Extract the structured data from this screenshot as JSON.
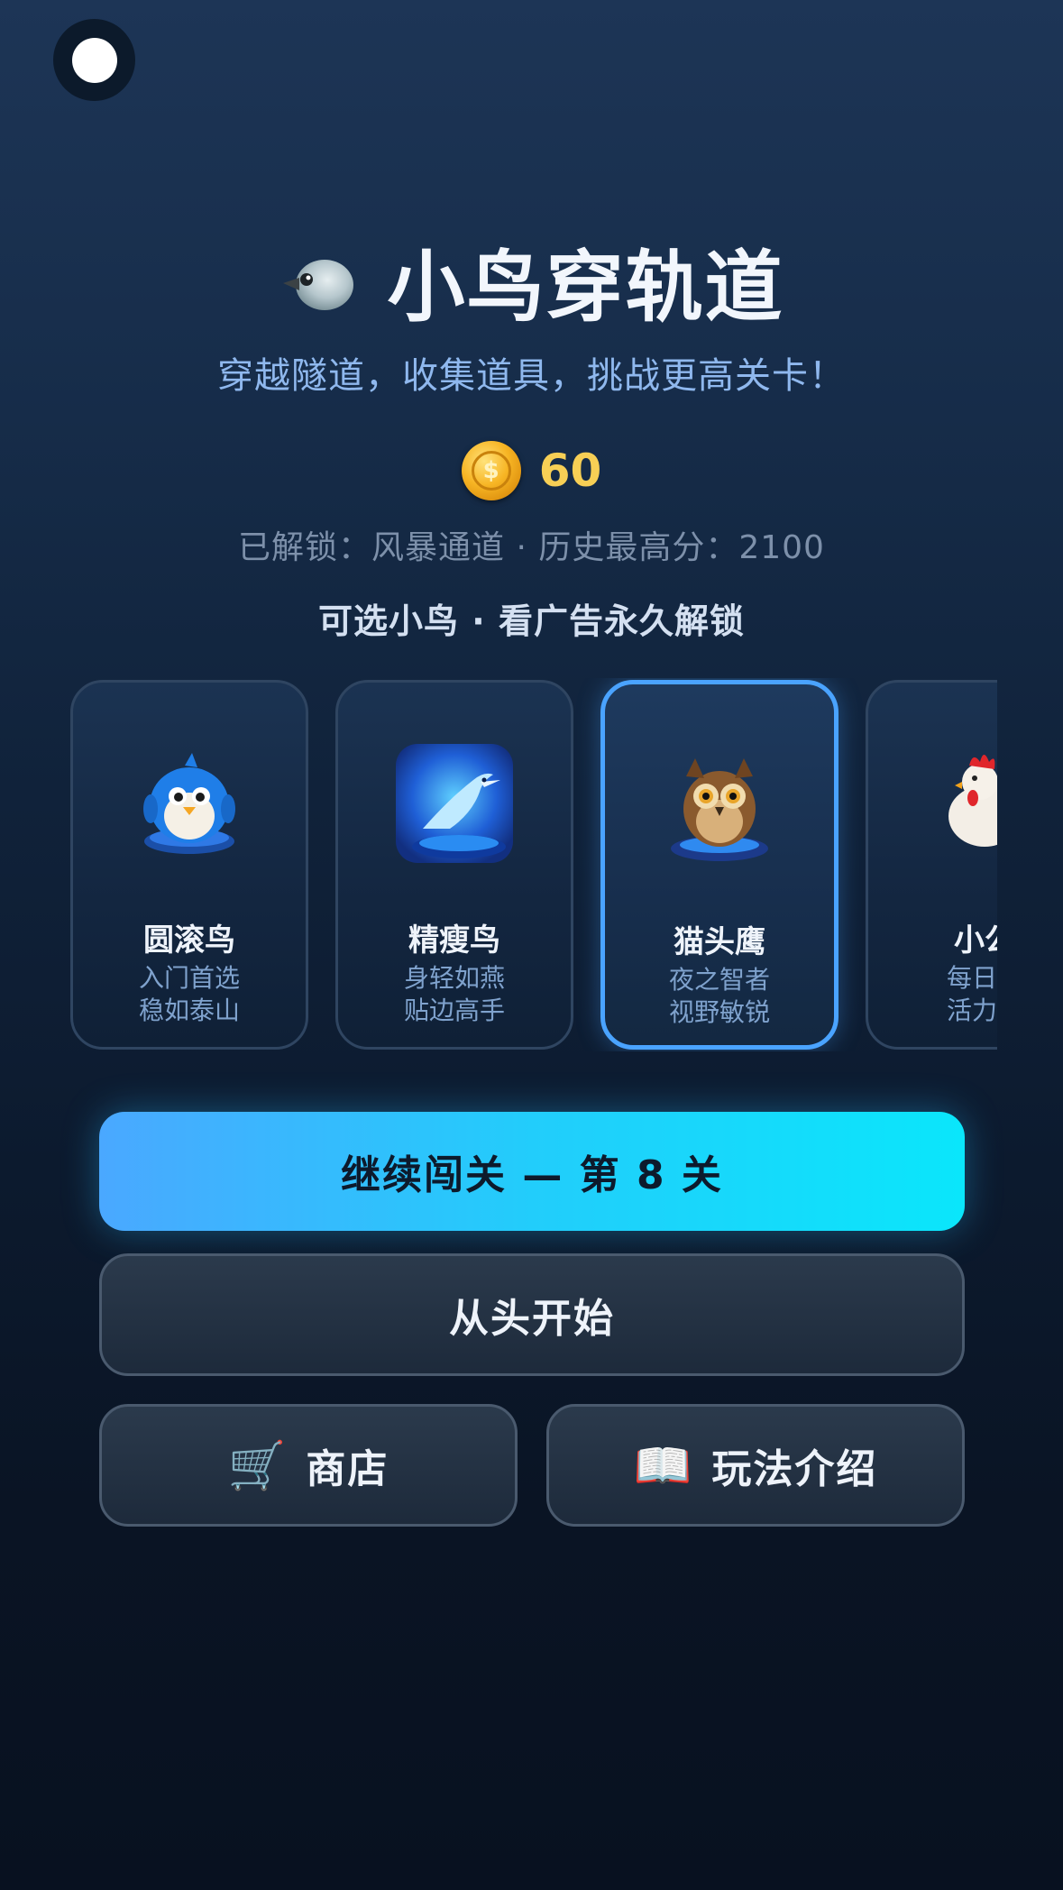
{
  "header": {
    "title": "小鸟穿轨道",
    "title_icon": "pigeon-icon",
    "subtitle": "穿越隧道，收集道具，挑战更高关卡！"
  },
  "wallet": {
    "coin_icon": "coin-icon",
    "coin_symbol": "$",
    "coins": "60"
  },
  "progress": {
    "text": "已解锁：风暴通道 · 历史最高分：2100"
  },
  "bird_select": {
    "title": "可选小鸟 · 看广告永久解锁",
    "selected_index": 2,
    "birds": [
      {
        "name": "圆滚鸟",
        "line1": "入门首选",
        "line2": "稳如泰山",
        "icon": "round-blue-bird-icon"
      },
      {
        "name": "精瘦鸟",
        "line1": "身轻如燕",
        "line2": "贴边高手",
        "icon": "slim-glowing-bird-icon"
      },
      {
        "name": "猫头鹰",
        "line1": "夜之智者",
        "line2": "视野敏锐",
        "icon": "owl-icon"
      },
      {
        "name": "小公",
        "line1": "每日打",
        "line2": "活力四",
        "icon": "rooster-icon"
      }
    ]
  },
  "buttons": {
    "continue": "继续闯关 — 第 8 关",
    "restart": "从头开始",
    "shop": "商店",
    "shop_icon": "shopping-cart-icon",
    "guide": "玩法介绍",
    "guide_icon": "open-book-icon"
  },
  "colors": {
    "accent": "#4aa3ff",
    "continue_start": "#4aa8ff",
    "continue_end": "#0ae6fb",
    "coin": "#f7cf55"
  }
}
